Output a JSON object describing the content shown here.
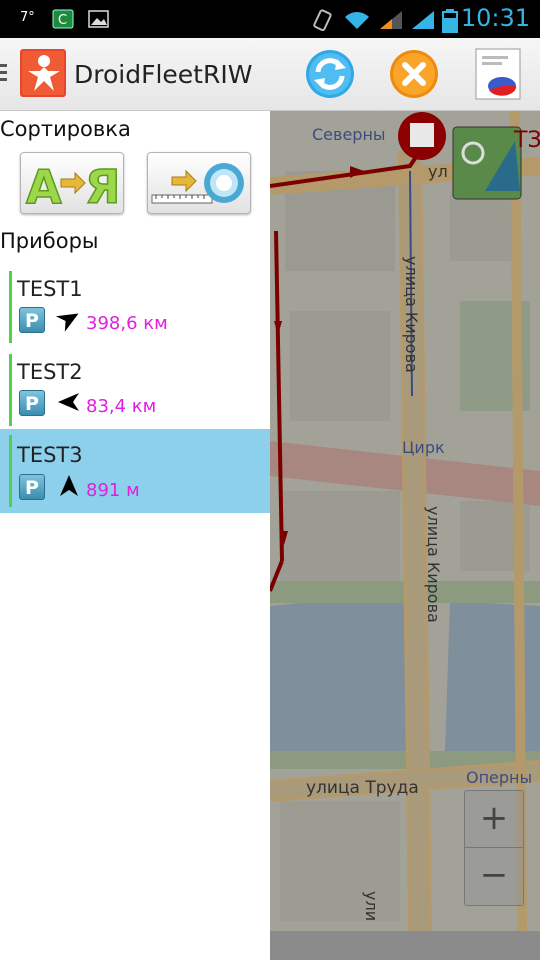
{
  "statusbar": {
    "temperature": "7°",
    "time": "10:31",
    "icons": [
      "cpu-app-icon",
      "gallery-icon",
      "vibrate-icon",
      "wifi-icon",
      "signal-icon",
      "signal-icon",
      "battery-icon"
    ]
  },
  "app": {
    "title": "DroidFleetRIW",
    "icons": [
      "menu-grip-icon",
      "app-logo-icon",
      "refresh-icon",
      "close-icon",
      "report-icon"
    ]
  },
  "sort": {
    "label": "Сортировка",
    "alpha_label": "А→Я"
  },
  "devices": {
    "label": "Приборы",
    "items": [
      {
        "name": "TEST1",
        "badge": "P",
        "distance": "398,6 км",
        "heading_deg": 60,
        "selected": false
      },
      {
        "name": "TEST2",
        "badge": "P",
        "distance": "83,4 км",
        "heading_deg": -90,
        "selected": false
      },
      {
        "name": "TEST3",
        "badge": "P",
        "distance": "891 м",
        "heading_deg": 0,
        "selected": true
      }
    ]
  },
  "map": {
    "labels": {
      "north": "Северны",
      "kirova1": "улица Кирова",
      "kirova2": "улица Кирова",
      "circus": "Цирк",
      "truda": "улица Труда",
      "opera": "Оперны",
      "top_right": "ул",
      "bottom": "ули",
      "marker_text": "ТЗ"
    },
    "zoom_in": "+",
    "zoom_out": "−",
    "colors": {
      "route": "#8b0000",
      "selected": "#8dd0ec",
      "distance": "#e020e0"
    }
  }
}
